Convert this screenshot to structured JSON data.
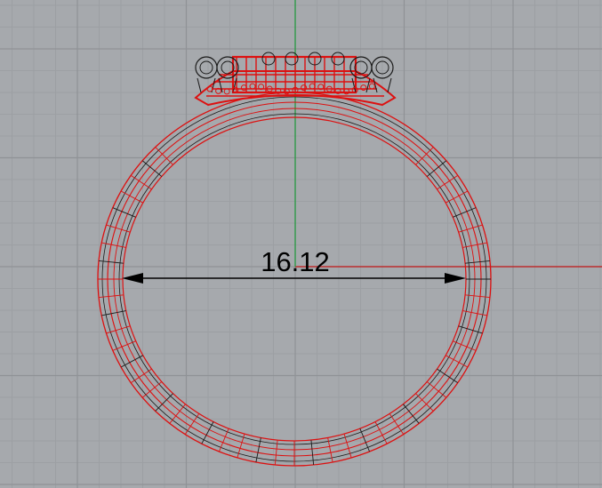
{
  "viewport": {
    "view": "Front",
    "background_color": "#a6a9ad",
    "grid": true,
    "grid_minor_color": "#9c9fa3",
    "grid_major_color": "#8f9296",
    "x_axis_color": "#c21818",
    "y_axis_color": "#1e9b3a"
  },
  "model": {
    "object": "ring-wireframe",
    "selected": true,
    "selection_color": "#dd1010",
    "wire_color": "#1a1a1a"
  },
  "dimension": {
    "type": "linear",
    "value": "16.12",
    "color": "#000000"
  }
}
